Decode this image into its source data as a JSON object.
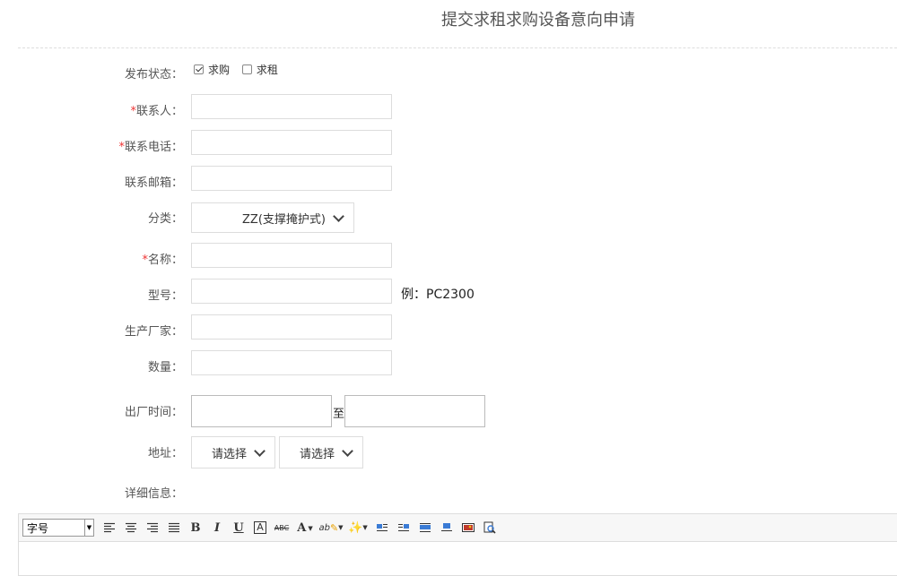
{
  "page": {
    "title": "提交求租求购设备意向申请"
  },
  "form": {
    "status": {
      "label": "发布状态：",
      "options": [
        {
          "label": "求购",
          "checked": true
        },
        {
          "label": "求租",
          "checked": false
        }
      ]
    },
    "contact": {
      "required_mark": "*",
      "label": "联系人：",
      "value": ""
    },
    "phone": {
      "required_mark": "*",
      "label": "联系电话：",
      "value": ""
    },
    "email": {
      "label": "联系邮箱：",
      "value": ""
    },
    "category": {
      "label": "分类：",
      "selected": "ZZ(支撑掩护式)"
    },
    "name": {
      "required_mark": "*",
      "label": "名称：",
      "value": ""
    },
    "model": {
      "label": "型号：",
      "value": "",
      "hint": "例：PC2300"
    },
    "manufacturer": {
      "label": "生产厂家：",
      "value": ""
    },
    "quantity": {
      "label": "数量：",
      "value": ""
    },
    "factory_time": {
      "label": "出厂时间：",
      "separator": "至"
    },
    "address": {
      "label": "地址：",
      "province": "请选择",
      "city": "请选择"
    },
    "details": {
      "label": "详细信息："
    }
  },
  "editor": {
    "font_size_label": "字号",
    "bold": "B",
    "italic": "I",
    "underline": "U",
    "font_border": "A",
    "strike": "ABC",
    "font_color": "A",
    "bg_color": "ab",
    "icons": [
      "align-left-icon",
      "align-center-icon",
      "align-right-icon",
      "justify-icon",
      "bold-icon",
      "italic-icon",
      "underline-icon",
      "font-border-icon",
      "strikethrough-icon",
      "font-color-icon",
      "highlight-icon",
      "magic-wand-icon",
      "image-left-icon",
      "image-right-icon",
      "image-float-icon",
      "image-center-icon",
      "insert-image-icon",
      "preview-icon"
    ]
  }
}
